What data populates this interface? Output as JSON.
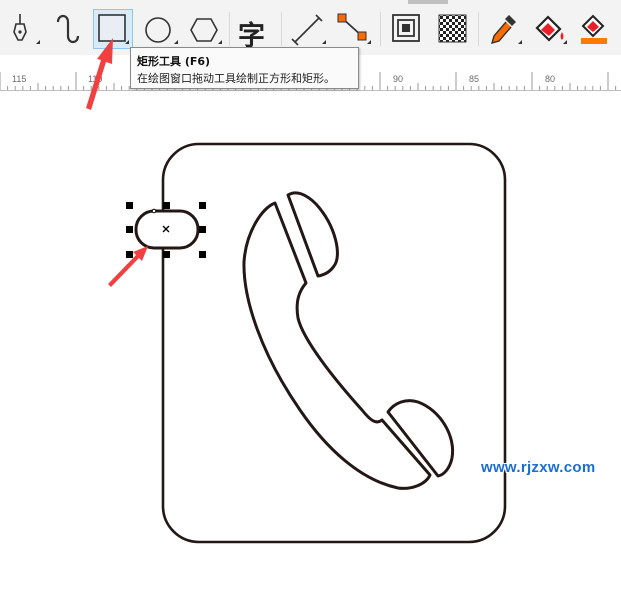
{
  "toolbar": {
    "tools": [
      {
        "name": "pen-tool",
        "icon": "pen-nib-icon"
      },
      {
        "name": "bspline-tool",
        "icon": "curve-icon"
      },
      {
        "name": "rectangle-tool",
        "icon": "rectangle-icon",
        "active": true
      },
      {
        "name": "ellipse-tool",
        "icon": "ellipse-icon"
      },
      {
        "name": "polygon-tool",
        "icon": "hexagon-icon"
      },
      {
        "name": "text-tool",
        "icon": "text-icon",
        "glyph": "字"
      },
      {
        "name": "parallel-dimension-tool",
        "icon": "dimension-line-icon"
      },
      {
        "name": "connector-tool",
        "icon": "connector-icon"
      },
      {
        "name": "contour-tool",
        "icon": "contour-icon"
      },
      {
        "name": "transparency-tool",
        "icon": "transparency-checker-icon"
      },
      {
        "name": "color-eyedropper-tool",
        "icon": "eyedropper-icon"
      },
      {
        "name": "interactive-fill-tool",
        "icon": "fill-bucket-icon"
      },
      {
        "name": "smart-fill-tool",
        "icon": "smart-fill-icon"
      }
    ]
  },
  "tooltip": {
    "title": "矩形工具 (F6)",
    "description": "在绘图窗口拖动工具绘制正方形和矩形。"
  },
  "ruler": {
    "labels": [
      "115",
      "110",
      "90",
      "85",
      "80"
    ]
  },
  "watermark": "www.rjzxw.com",
  "colors": {
    "accent_arrow": "#f04040",
    "watermark": "#1a6fd0",
    "stroke": "#231815",
    "active_tool_bg": "#d8ebf9"
  }
}
